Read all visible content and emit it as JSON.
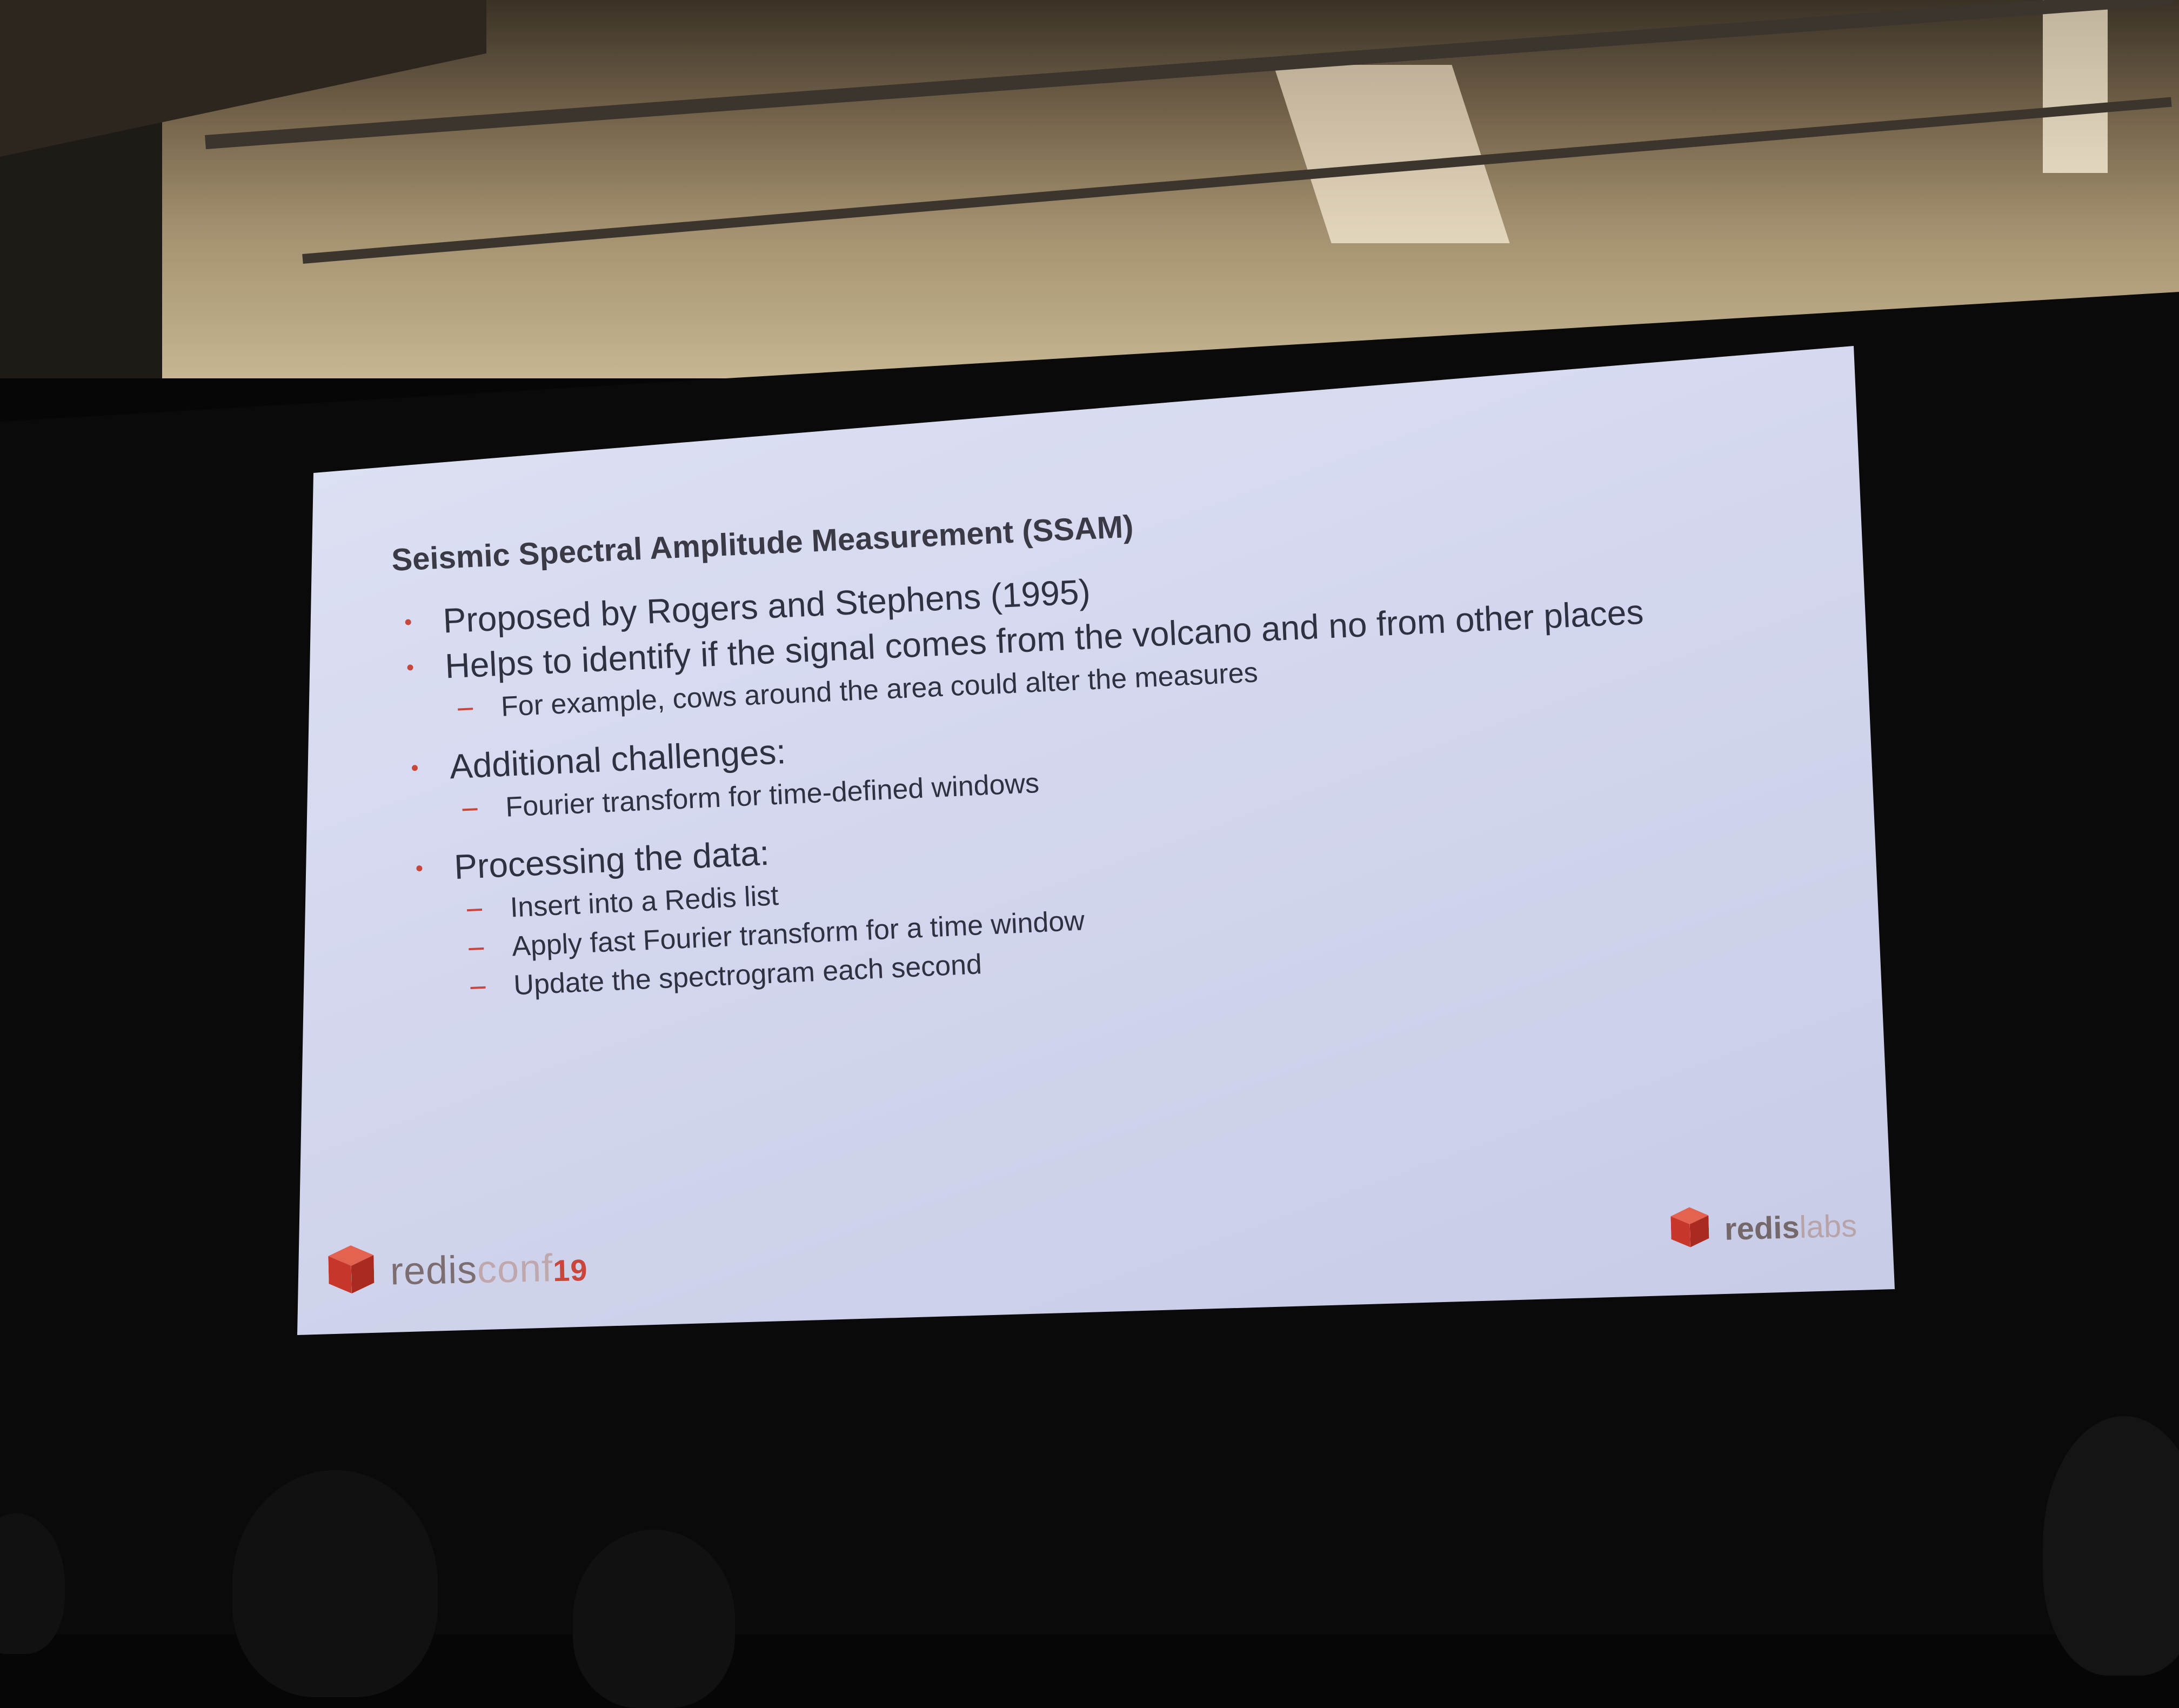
{
  "slide": {
    "title": "Seismic Spectral Amplitude Measurement (SSAM)",
    "bullets": [
      {
        "text": "Proposed by Rogers and Stephens (1995)",
        "subitems": []
      },
      {
        "text": "Helps to identify if the signal comes from the volcano and no from other places",
        "subitems": [
          "For example, cows around the area could alter the measures"
        ]
      },
      {
        "text": "Additional challenges:",
        "subitems": [
          "Fourier transform for time-defined windows"
        ]
      },
      {
        "text": "Processing the data:",
        "subitems": [
          "Insert into a Redis list",
          "Apply fast Fourier transform for a time window",
          "Update the spectrogram each second"
        ]
      }
    ]
  },
  "footer": {
    "left_logo": {
      "redis": "redis",
      "conf": "conf",
      "year": "19"
    },
    "right_logo": {
      "redis": "redis",
      "labs": "labs"
    }
  },
  "colors": {
    "accent": "#c9463c",
    "slide_bg": "#d6d9ef",
    "text": "#2f3040"
  }
}
